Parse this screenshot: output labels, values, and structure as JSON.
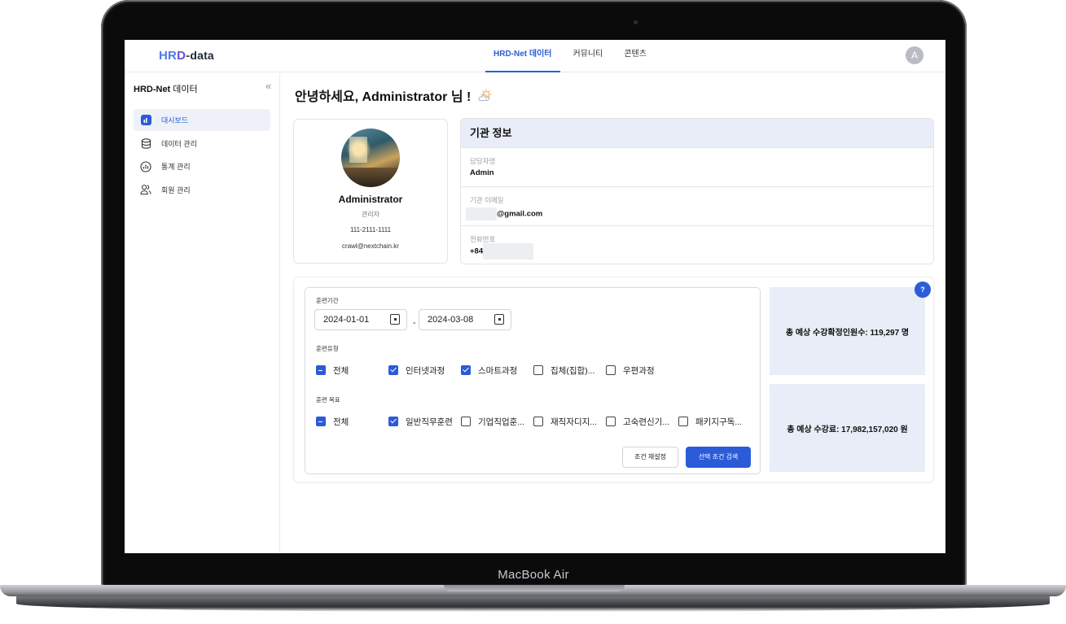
{
  "device": {
    "label": "MacBook Air"
  },
  "header": {
    "logo": {
      "part1": "HR",
      "part2": "D",
      "dash": "-",
      "part3": "data"
    },
    "tabs": [
      {
        "label": "HRD-Net 데이터",
        "active": true
      },
      {
        "label": "커뮤니티",
        "active": false
      },
      {
        "label": "콘텐츠",
        "active": false
      }
    ],
    "avatar_initial": "A"
  },
  "sidebar": {
    "title_bold": "HRD-Net",
    "title_rest": " 데이터",
    "items": [
      {
        "label": "대시보드",
        "icon": "bar-chart-icon",
        "active": true
      },
      {
        "label": "데이터 관리",
        "icon": "database-icon",
        "active": false
      },
      {
        "label": "통계 관리",
        "icon": "stats-icon",
        "active": false
      },
      {
        "label": "회원 관리",
        "icon": "users-icon",
        "active": false
      }
    ]
  },
  "greeting": "안녕하세요, Administrator 님 !",
  "profile": {
    "name": "Administrator",
    "role": "관리자",
    "phone": "111-2111-1111",
    "email": "crawl@nextchain.kr"
  },
  "org": {
    "title": "기관 정보",
    "fields": [
      {
        "label": "담당자명",
        "value": "Admin"
      },
      {
        "label": "기관 이메일",
        "value": "@gmail.com"
      },
      {
        "label": "전화번호",
        "value": "+84"
      }
    ]
  },
  "filters": {
    "period_label": "훈련기간",
    "start_date": "2024-01-01",
    "end_date": "2024-03-08",
    "date_sep": "-",
    "type_label": "훈련유형",
    "types": [
      {
        "label": "전체",
        "state": "indeterminate"
      },
      {
        "label": "인터넷과정",
        "state": "checked"
      },
      {
        "label": "스마트과정",
        "state": "checked"
      },
      {
        "label": "집체(집합)...",
        "state": "unchecked"
      },
      {
        "label": "우편과정",
        "state": "unchecked"
      }
    ],
    "goal_label": "훈련 목표",
    "goals": [
      {
        "label": "전체",
        "state": "indeterminate"
      },
      {
        "label": "일반직무훈련",
        "state": "checked"
      },
      {
        "label": "기업직업훈...",
        "state": "unchecked"
      },
      {
        "label": "재직자디지...",
        "state": "unchecked"
      },
      {
        "label": "고숙련신기...",
        "state": "unchecked"
      },
      {
        "label": "패키지구독...",
        "state": "unchecked"
      }
    ],
    "reset_label": "조건 재설정",
    "search_label": "선택 조건 검색"
  },
  "stats": {
    "help": "?",
    "expected_students": "총 예상 수강확정인원수: 119,297 명",
    "expected_fee": "총 예상 수강료: 17,982,157,020 원"
  },
  "colors": {
    "accent": "#2b5bd7",
    "panel": "#e8edf8"
  }
}
